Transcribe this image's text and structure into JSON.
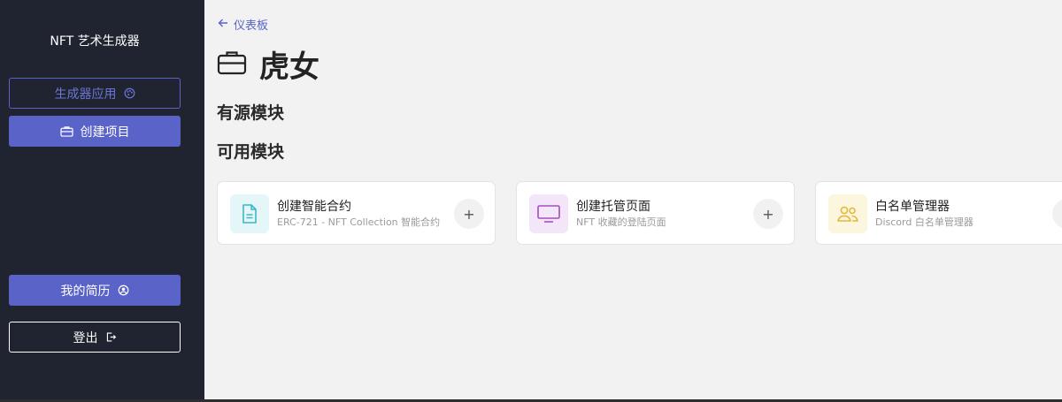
{
  "sidebar": {
    "brand": "NFT 艺术生成器",
    "generator_app_label": "生成器应用",
    "create_project_label": "创建项目",
    "profile_label": "我的简历",
    "logout_label": "登出"
  },
  "main": {
    "back_label": "仪表板",
    "title": "虎女",
    "section_active": "有源模块",
    "section_available": "可用模块",
    "cards": [
      {
        "title": "创建智能合约",
        "subtitle": "ERC-721 - NFT Collection 智能合约",
        "icon": "document-icon",
        "color": "#3bb7c9",
        "bg": "#e5f6f8"
      },
      {
        "title": "创建托管页面",
        "subtitle": "NFT 收藏的登陆页面",
        "icon": "monitor-icon",
        "color": "#a64fc0",
        "bg": "#f3e6f8"
      },
      {
        "title": "白名单管理器",
        "subtitle": "Discord 白名单管理器",
        "icon": "users-icon",
        "color": "#e2b93b",
        "bg": "#fdf6de"
      }
    ],
    "add_symbol": "+"
  },
  "colors": {
    "sidebar_bg": "#1f2430",
    "accent": "#5a63c8",
    "page_bg": "#f2f2f2"
  }
}
